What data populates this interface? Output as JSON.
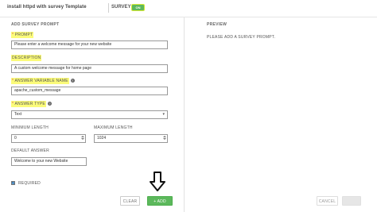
{
  "header": {
    "title": "install httpd with survey Template",
    "survey_label": "SURVEY",
    "toggle_label": "ON"
  },
  "form": {
    "section_title": "ADD SURVEY PROMPT",
    "prompt": {
      "label": "PROMPT",
      "value": "Please enter a welcome message for your new website"
    },
    "description": {
      "label": "DESCRIPTION",
      "value": "A custom welcome message for home page"
    },
    "variable": {
      "label": "ANSWER VARIABLE NAME",
      "value": "apache_custom_message"
    },
    "answer_type": {
      "label": "ANSWER TYPE",
      "value": "Text"
    },
    "min_length": {
      "label": "MINIMUM LENGTH",
      "value": "0"
    },
    "max_length": {
      "label": "MAXIMUM LENGTH",
      "value": "1024"
    },
    "default_answer": {
      "label": "DEFAULT ANSWER",
      "value": "Welcome to your new Website"
    },
    "required": {
      "label": "REQUIRED",
      "checked": true
    },
    "clear_label": "CLEAR",
    "add_label": "+ ADD"
  },
  "preview": {
    "title": "PREVIEW",
    "message": "PLEASE ADD A SURVEY PROMPT."
  },
  "footer": {
    "cancel_label": "CANCEL",
    "save_label": "SAVE"
  },
  "colors": {
    "highlight": "#fbfb7a",
    "add_green": "#5cb85c",
    "toggle_green": "#5cb85c"
  },
  "icons": [
    "question-icon",
    "caret-down-icon",
    "check-icon",
    "down-arrow-icon"
  ]
}
